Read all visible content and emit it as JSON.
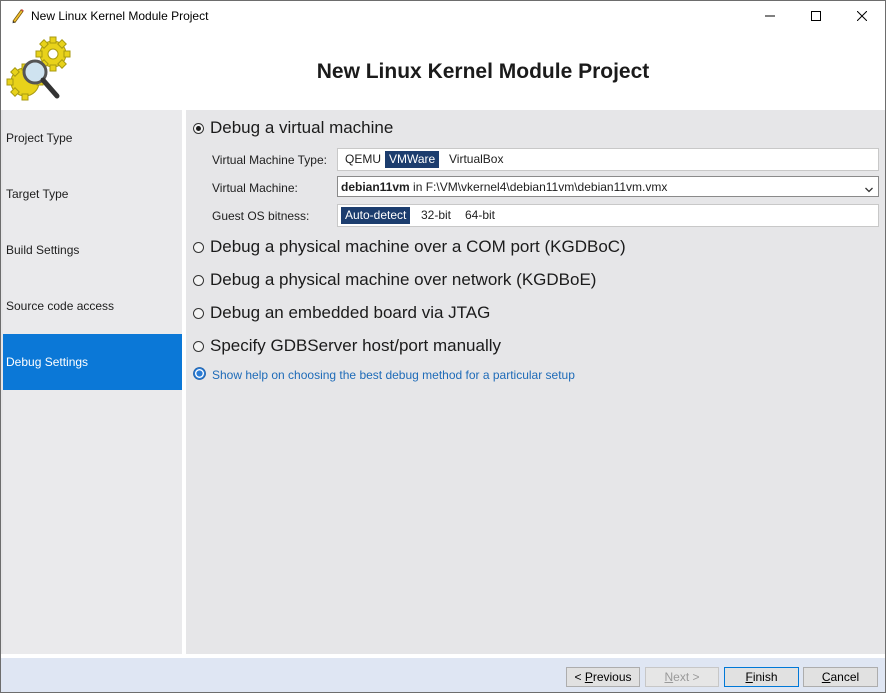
{
  "window": {
    "title": "New Linux Kernel Module Project",
    "app_icon": "pencil-icon"
  },
  "header": {
    "title": "New Linux Kernel Module Project",
    "logo_icon": "gears-magnifier-icon"
  },
  "sidebar": {
    "items": [
      {
        "label": "Project Type",
        "active": false
      },
      {
        "label": "Target Type",
        "active": false
      },
      {
        "label": "Build Settings",
        "active": false
      },
      {
        "label": "Source code access",
        "active": false
      },
      {
        "label": "Debug Settings",
        "active": true
      }
    ],
    "active_color": "#0b78d7"
  },
  "debug": {
    "options": [
      {
        "label": "Debug a virtual machine",
        "checked": true
      },
      {
        "label": "Debug a physical machine over a COM port (KGDBoC)",
        "checked": false
      },
      {
        "label": "Debug a physical machine over network (KGDBoE)",
        "checked": false
      },
      {
        "label": "Debug an embedded board via JTAG",
        "checked": false
      },
      {
        "label": "Specify GDBServer host/port manually",
        "checked": false
      }
    ],
    "vm_type": {
      "label": "Virtual Machine Type:",
      "choices": [
        "QEMU",
        "VMWare",
        "VirtualBox"
      ],
      "selected": "VMWare"
    },
    "vm": {
      "label": "Virtual Machine:",
      "name": "debian11vm",
      "path": " in F:\\VM\\vkernel4\\debian11vm\\debian11vm.vmx"
    },
    "bitness": {
      "label": "Guest OS bitness:",
      "choices": [
        "Auto-detect",
        "32-bit",
        "64-bit"
      ],
      "selected": "Auto-detect"
    },
    "help_link": "Show help on choosing the best debug method for a particular setup"
  },
  "footer": {
    "previous": {
      "prefix": "< ",
      "mnemonic": "P",
      "rest": "revious"
    },
    "next": {
      "mnemonic": "N",
      "rest": "ext >"
    },
    "finish": {
      "mnemonic": "F",
      "rest": "inish"
    },
    "cancel": {
      "mnemonic": "C",
      "rest": "ancel"
    }
  }
}
